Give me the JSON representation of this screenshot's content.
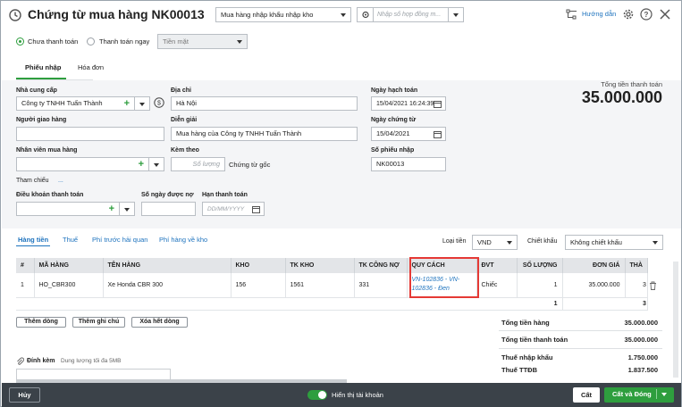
{
  "window": {
    "title": "Chứng từ mua hàng NK00013",
    "import_type": "Mua hàng nhập khẩu nhập kho",
    "search_placeholder": "Nhập số hợp đồng m...",
    "help_label": "Hướng dẫn"
  },
  "payment": {
    "unpaid_label": "Chưa thanh toán",
    "paid_now_label": "Thanh toán ngay",
    "method": "Tiền mặt",
    "selected": "unpaid"
  },
  "tabs": [
    {
      "label": "Phiếu nhập",
      "active": true
    },
    {
      "label": "Hóa đơn",
      "active": false
    }
  ],
  "form": {
    "supplier": {
      "label": "Nhà cung cấp",
      "value": "Công ty TNHH Tuấn Thành"
    },
    "address": {
      "label": "Địa chỉ",
      "value": "Hà Nội"
    },
    "recipient": {
      "label": "Người giao hàng",
      "value": ""
    },
    "description": {
      "label": "Diễn giải",
      "value": "Mua hàng của Công ty TNHH Tuấn Thành"
    },
    "employee": {
      "label": "Nhân viên mua hàng",
      "value": ""
    },
    "attach_count": {
      "label": "Kèm theo",
      "placeholder": "Số lượng",
      "suffix": "Chứng từ gốc"
    },
    "reference": {
      "label": "Tham chiếu",
      "value": "..."
    },
    "payment_terms": {
      "label": "Điều khoản thanh toán",
      "value": ""
    },
    "credit_days": {
      "label": "Số ngày được nợ",
      "value": ""
    },
    "due_date": {
      "label": "Hạn thanh toán",
      "placeholder": "DD/MM/YYYY"
    },
    "posting_date": {
      "label": "Ngày hạch toán",
      "value": "15/04/2021 16:24:39"
    },
    "voucher_date": {
      "label": "Ngày chứng từ",
      "value": "15/04/2021"
    },
    "voucher_no": {
      "label": "Số phiếu nhập",
      "value": "NK00013"
    }
  },
  "total_payment": {
    "label": "Tổng tiền thanh toán",
    "value": "35.000.000"
  },
  "detail_tabs": [
    "Hàng tiền",
    "Thuế",
    "Phí trước hải quan",
    "Phí hàng về kho"
  ],
  "currency": {
    "label": "Loại tiền",
    "value": "VND"
  },
  "discount": {
    "label": "Chiết khấu",
    "value": "Không chiết khấu"
  },
  "table": {
    "columns": [
      "#",
      "MÃ HÀNG",
      "TÊN HÀNG",
      "KHO",
      "TK KHO",
      "TK CÔNG NỢ",
      "QUY CÁCH",
      "ĐVT",
      "SỐ LƯỢNG",
      "ĐƠN GIÁ",
      "THÀ"
    ],
    "rows": [
      {
        "no": "1",
        "code": "HO_CBR300",
        "name": "Xe Honda CBR 300",
        "warehouse": "156",
        "stock_account": "1561",
        "payable_account": "331",
        "spec": "VN-102836 - VN-102836 - Đen",
        "unit": "Chiếc",
        "qty": "1",
        "price": "35.000.000",
        "amount": "3"
      }
    ],
    "footer": {
      "qty": "1",
      "amount": "3"
    }
  },
  "actions": {
    "add_row": "Thêm dòng",
    "add_note": "Thêm ghi chú",
    "clear_all": "Xóa hết dòng"
  },
  "totals": [
    {
      "label": "Tổng tiền hàng",
      "value": "35.000.000"
    },
    {
      "label": "Tổng tiền thanh toán",
      "value": "35.000.000"
    },
    {
      "label": "Thuế nhập khẩu",
      "value": "1.750.000"
    },
    {
      "label": "Thuế TTĐB",
      "value": "1.837.500"
    }
  ],
  "attachment": {
    "label": "Đính kèm",
    "hint": "Dung lượng tối đa 5MB"
  },
  "footer": {
    "cancel": "Hủy",
    "show_accounts": "Hiển thị tài khoản",
    "save": "Cất",
    "save_close": "Cất và Đóng"
  },
  "colors": {
    "accent": "#2e9e3e",
    "link": "#1e73be",
    "highlight": "#e53935",
    "footer_bg": "#3b4249"
  }
}
